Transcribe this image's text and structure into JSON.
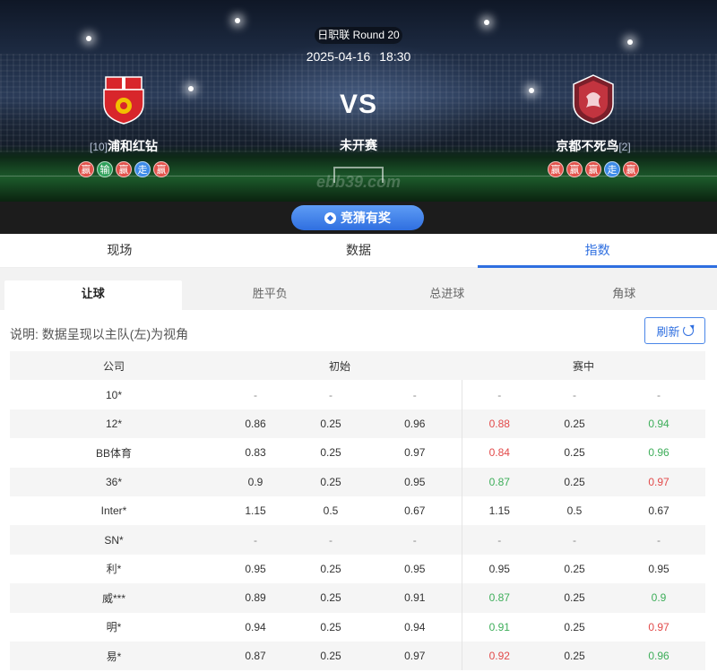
{
  "match": {
    "league_round": "日职联 Round 20",
    "date": "2025-04-16",
    "time": "18:30",
    "vs": "VS",
    "status": "未开赛",
    "watermark": "ebb39.com"
  },
  "home_team": {
    "rank": "[10]",
    "name": "浦和红钻",
    "form": [
      "赢",
      "输",
      "赢",
      "走",
      "赢"
    ],
    "crest_icon": "urawa-reds-crest-icon",
    "colors": {
      "primary": "#d8262b",
      "accent": "#f2c100"
    }
  },
  "away_team": {
    "name": "京都不死鸟",
    "rank": "[2]",
    "form": [
      "赢",
      "赢",
      "赢",
      "走",
      "赢"
    ],
    "crest_icon": "kyoto-sanga-crest-icon",
    "colors": {
      "primary": "#7b1f2a",
      "accent": "#c2343f"
    }
  },
  "form_colors": {
    "赢": "#e2524b",
    "输": "#2ea05a",
    "走": "#3d8be8"
  },
  "guess_button": {
    "label": "竞猜有奖"
  },
  "main_tabs": [
    {
      "label": "现场",
      "active": false
    },
    {
      "label": "数据",
      "active": false
    },
    {
      "label": "指数",
      "active": true
    }
  ],
  "sub_tabs": [
    {
      "label": "让球",
      "active": true
    },
    {
      "label": "胜平负",
      "active": false
    },
    {
      "label": "总进球",
      "active": false
    },
    {
      "label": "角球",
      "active": false
    }
  ],
  "note": "说明: 数据呈现以主队(左)为视角",
  "refresh_label": "刷新",
  "table": {
    "headers": {
      "company": "公司",
      "initial": "初始",
      "live": "赛中"
    },
    "rows": [
      {
        "company": "10*",
        "initial": [
          "-",
          "-",
          "-"
        ],
        "live": [
          "-",
          "-",
          "-"
        ],
        "live_trend": [
          "",
          "",
          ""
        ]
      },
      {
        "company": "12*",
        "initial": [
          "0.86",
          "0.25",
          "0.96"
        ],
        "live": [
          "0.88",
          "0.25",
          "0.94"
        ],
        "live_trend": [
          "up",
          "",
          "down"
        ]
      },
      {
        "company": "BB体育",
        "initial": [
          "0.83",
          "0.25",
          "0.97"
        ],
        "live": [
          "0.84",
          "0.25",
          "0.96"
        ],
        "live_trend": [
          "up",
          "",
          "down"
        ]
      },
      {
        "company": "36*",
        "initial": [
          "0.9",
          "0.25",
          "0.95"
        ],
        "live": [
          "0.87",
          "0.25",
          "0.97"
        ],
        "live_trend": [
          "down",
          "",
          "up"
        ]
      },
      {
        "company": "Inter*",
        "initial": [
          "1.15",
          "0.5",
          "0.67"
        ],
        "live": [
          "1.15",
          "0.5",
          "0.67"
        ],
        "live_trend": [
          "",
          "",
          ""
        ]
      },
      {
        "company": "SN*",
        "initial": [
          "-",
          "-",
          "-"
        ],
        "live": [
          "-",
          "-",
          "-"
        ],
        "live_trend": [
          "",
          "",
          ""
        ]
      },
      {
        "company": "利*",
        "initial": [
          "0.95",
          "0.25",
          "0.95"
        ],
        "live": [
          "0.95",
          "0.25",
          "0.95"
        ],
        "live_trend": [
          "",
          "",
          ""
        ]
      },
      {
        "company": "威***",
        "initial": [
          "0.89",
          "0.25",
          "0.91"
        ],
        "live": [
          "0.87",
          "0.25",
          "0.9"
        ],
        "live_trend": [
          "down",
          "",
          "down"
        ]
      },
      {
        "company": "明*",
        "initial": [
          "0.94",
          "0.25",
          "0.94"
        ],
        "live": [
          "0.91",
          "0.25",
          "0.97"
        ],
        "live_trend": [
          "down",
          "",
          "up"
        ]
      },
      {
        "company": "易*",
        "initial": [
          "0.87",
          "0.25",
          "0.97"
        ],
        "live": [
          "0.92",
          "0.25",
          "0.96"
        ],
        "live_trend": [
          "up",
          "",
          "down"
        ]
      }
    ]
  },
  "trend_colors": {
    "up": "#e24a4a",
    "down": "#3eae5a"
  },
  "accent_color": "#2f6fe0"
}
